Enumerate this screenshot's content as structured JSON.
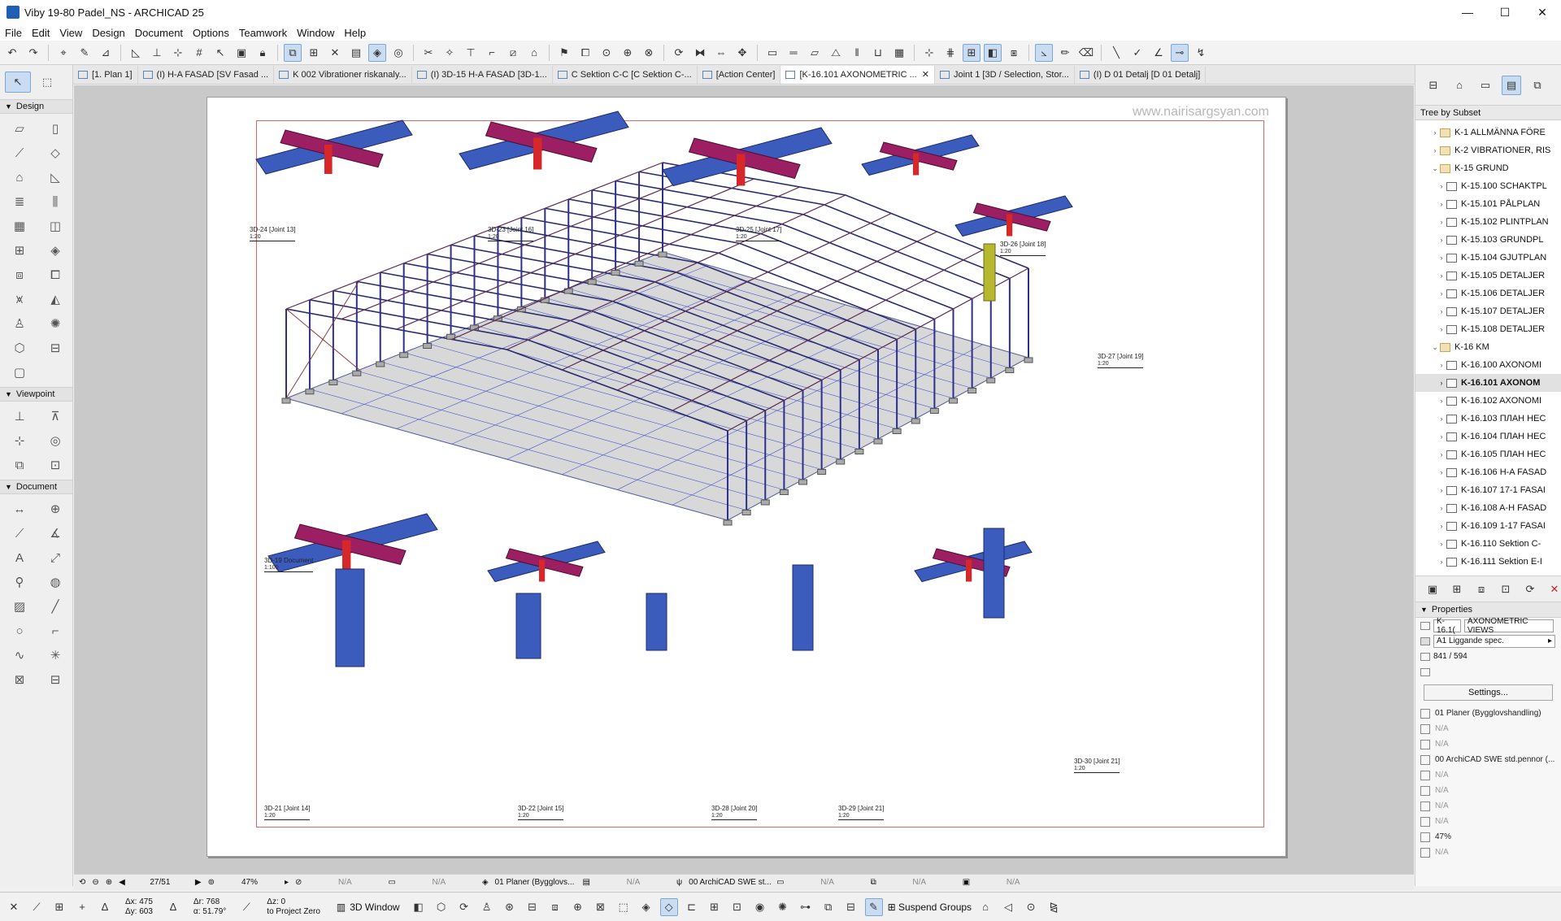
{
  "window": {
    "title": "Viby 19-80 Padel_NS - ARCHICAD 25",
    "controls": {
      "minimize": "—",
      "maximize": "☐",
      "close": "✕"
    }
  },
  "menu": [
    "File",
    "Edit",
    "View",
    "Design",
    "Document",
    "Options",
    "Teamwork",
    "Window",
    "Help"
  ],
  "tabs": [
    {
      "label": "[1. Plan 1]",
      "active": false
    },
    {
      "label": "(I) H-A FASAD  [SV Fasad ...",
      "active": false
    },
    {
      "label": "K 002 Vibrationer riskanaly...",
      "active": false
    },
    {
      "label": "(I) 3D-15 H-A FASAD [3D-1...",
      "active": false
    },
    {
      "label": "C Sektion C-C [C Sektion C-...",
      "active": false
    },
    {
      "label": "[Action Center]",
      "active": false
    },
    {
      "label": "[K-16.101 AXONOMETRIC ...",
      "active": true
    },
    {
      "label": "Joint 1 [3D / Selection, Stor...",
      "active": false
    },
    {
      "label": "(I) D 01 Detalj [D 01 Detalj]",
      "active": false
    }
  ],
  "left_palette": {
    "sections": {
      "design": "Design",
      "viewpoint": "Viewpoint",
      "document": "Document"
    }
  },
  "canvas": {
    "watermark": "www.nairisargsyan.com",
    "drawing_labels": [
      {
        "name": "3D-24 [Joint 13]",
        "scale": "1:20"
      },
      {
        "name": "3D-23 [Joint 16]",
        "scale": "1:20"
      },
      {
        "name": "3D-25 [Joint 17]",
        "scale": "1:20"
      },
      {
        "name": "3D-26 [Joint 18]",
        "scale": "1:20"
      },
      {
        "name": "3D-27 [Joint 19]",
        "scale": "1:20"
      },
      {
        "name": "3D-19 Document",
        "scale": "1:100"
      },
      {
        "name": "3D-21 [Joint 14]",
        "scale": "1:20"
      },
      {
        "name": "3D-22 [Joint 15]",
        "scale": "1:20"
      },
      {
        "name": "3D-28 [Joint 20]",
        "scale": "1:20"
      },
      {
        "name": "3D-29 [Joint 21]",
        "scale": "1:20"
      },
      {
        "name": "3D-30 [Joint 21]",
        "scale": "1:20"
      }
    ]
  },
  "navigator": {
    "header": "Tree by Subset",
    "items": [
      {
        "label": "K-1 ALLMÄNNA FÖRE",
        "type": "folder",
        "indent": 1,
        "expanded": false
      },
      {
        "label": "K-2 VIBRATIONER, RIS",
        "type": "folder",
        "indent": 1,
        "expanded": false
      },
      {
        "label": "K-15 GRUND",
        "type": "folder",
        "indent": 1,
        "expanded": true
      },
      {
        "label": "K-15.100 SCHAKTPL",
        "type": "layout",
        "indent": 2
      },
      {
        "label": "K-15.101 PÅLPLAN",
        "type": "layout",
        "indent": 2
      },
      {
        "label": "K-15.102 PLINTPLAN",
        "type": "layout",
        "indent": 2
      },
      {
        "label": "K-15.103 GRUNDPL",
        "type": "layout",
        "indent": 2
      },
      {
        "label": "K-15.104 GJUTPLAN",
        "type": "layout",
        "indent": 2
      },
      {
        "label": "K-15.105 DETALJER",
        "type": "layout",
        "indent": 2
      },
      {
        "label": "K-15.106 DETALJER",
        "type": "layout",
        "indent": 2
      },
      {
        "label": "K-15.107 DETALJER",
        "type": "layout",
        "indent": 2
      },
      {
        "label": "K-15.108 DETALJER",
        "type": "layout",
        "indent": 2
      },
      {
        "label": "K-16 KM",
        "type": "folder",
        "indent": 1,
        "expanded": true
      },
      {
        "label": "K-16.100 AXONOMI",
        "type": "layout",
        "indent": 2
      },
      {
        "label": "K-16.101 AXONOM",
        "type": "layout",
        "indent": 2,
        "selected": true
      },
      {
        "label": "K-16.102 AXONOMI",
        "type": "layout",
        "indent": 2
      },
      {
        "label": "K-16.103 ПЛАН НЕС",
        "type": "layout",
        "indent": 2
      },
      {
        "label": "K-16.104 ПЛАН НЕС",
        "type": "layout",
        "indent": 2
      },
      {
        "label": "K-16.105 ПЛАН НЕС",
        "type": "layout",
        "indent": 2
      },
      {
        "label": "K-16.106 H-A FASAD",
        "type": "layout",
        "indent": 2
      },
      {
        "label": "K-16.107 17-1 FASAI",
        "type": "layout",
        "indent": 2
      },
      {
        "label": "K-16.108 A-H FASAD",
        "type": "layout",
        "indent": 2
      },
      {
        "label": "K-16.109 1-17 FASAI",
        "type": "layout",
        "indent": 2
      },
      {
        "label": "K-16.110 Sektion C-",
        "type": "layout",
        "indent": 2
      },
      {
        "label": "K-16.111 Sektion E-I",
        "type": "layout",
        "indent": 2
      }
    ]
  },
  "properties": {
    "header": "Properties",
    "id_field": "K-16.1(",
    "name_field": "AXONOMETRIC VIEWS",
    "master": "A1 Liggande spec.",
    "size": "841 / 594",
    "settings_label": "Settings...",
    "layers": [
      {
        "label": "01 Planer (Bygglovshandling)",
        "na": false
      },
      {
        "label": "N/A",
        "na": true
      },
      {
        "label": "N/A",
        "na": true
      },
      {
        "label": "00 ArchiCAD SWE std.pennor (...",
        "na": false
      },
      {
        "label": "N/A",
        "na": true
      },
      {
        "label": "N/A",
        "na": true
      },
      {
        "label": "N/A",
        "na": true
      },
      {
        "label": "N/A",
        "na": true
      },
      {
        "label": "47%",
        "na": false
      },
      {
        "label": "N/A",
        "na": true
      }
    ]
  },
  "navbar": {
    "page": "27/51",
    "zoom": "47%",
    "na": "N/A",
    "layer_combo": "01 Planer (Bygglovs...",
    "pen_set": "00 ArchiCAD SWE st..."
  },
  "statusbar": {
    "dx": "Δx: 475",
    "dy": "Δy: 603",
    "dr": "Δr: 768",
    "da": "α: 51.79°",
    "dz": "Δz: 0",
    "to_zero": "to Project Zero",
    "window_label": "3D Window",
    "suspend_groups": "Suspend Groups"
  },
  "colors": {
    "accent": "#1f5fb5",
    "sheet_border": "#e06666",
    "beam_blue": "#3b5bbd",
    "beam_magenta": "#9c1f63"
  }
}
